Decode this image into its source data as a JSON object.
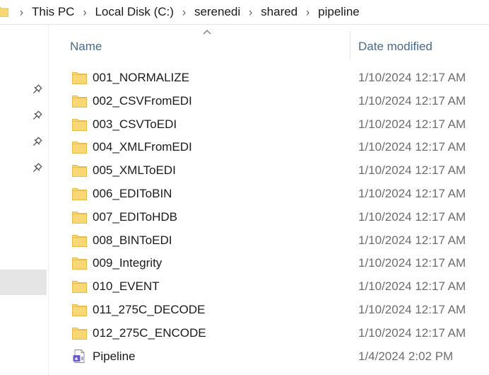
{
  "address_bar": {
    "breadcrumbs": [
      "This PC",
      "Local Disk (C:)",
      "serenedi",
      "shared",
      "pipeline"
    ]
  },
  "columns": {
    "name": "Name",
    "date_modified": "Date modified"
  },
  "files": [
    {
      "name": "001_NORMALIZE",
      "date": "1/10/2024 12:17 AM",
      "icon": "folder-icon"
    },
    {
      "name": "002_CSVFromEDI",
      "date": "1/10/2024 12:17 AM",
      "icon": "folder-icon"
    },
    {
      "name": "003_CSVToEDI",
      "date": "1/10/2024 12:17 AM",
      "icon": "folder-icon"
    },
    {
      "name": "004_XMLFromEDI",
      "date": "1/10/2024 12:17 AM",
      "icon": "folder-icon"
    },
    {
      "name": "005_XMLToEDI",
      "date": "1/10/2024 12:17 AM",
      "icon": "folder-icon"
    },
    {
      "name": "006_EDIToBIN",
      "date": "1/10/2024 12:17 AM",
      "icon": "folder-icon"
    },
    {
      "name": "007_EDIToHDB",
      "date": "1/10/2024 12:17 AM",
      "icon": "folder-icon"
    },
    {
      "name": "008_BINToEDI",
      "date": "1/10/2024 12:17 AM",
      "icon": "folder-icon"
    },
    {
      "name": "009_Integrity",
      "date": "1/10/2024 12:17 AM",
      "icon": "folder-icon"
    },
    {
      "name": "010_EVENT",
      "date": "1/10/2024 12:17 AM",
      "icon": "folder-icon"
    },
    {
      "name": "011_275C_DECODE",
      "date": "1/10/2024 12:17 AM",
      "icon": "folder-icon"
    },
    {
      "name": "012_275C_ENCODE",
      "date": "1/10/2024 12:17 AM",
      "icon": "folder-icon"
    },
    {
      "name": "Pipeline",
      "date": "1/4/2024 2:02 PM",
      "icon": "solution-file-icon"
    }
  ],
  "colors": {
    "folder": "#f8d775",
    "folder_dark": "#e8b84a",
    "header_text": "#4a6a8a",
    "date_text": "#6d6d6d",
    "nav_selected": "#e5e5e5"
  }
}
